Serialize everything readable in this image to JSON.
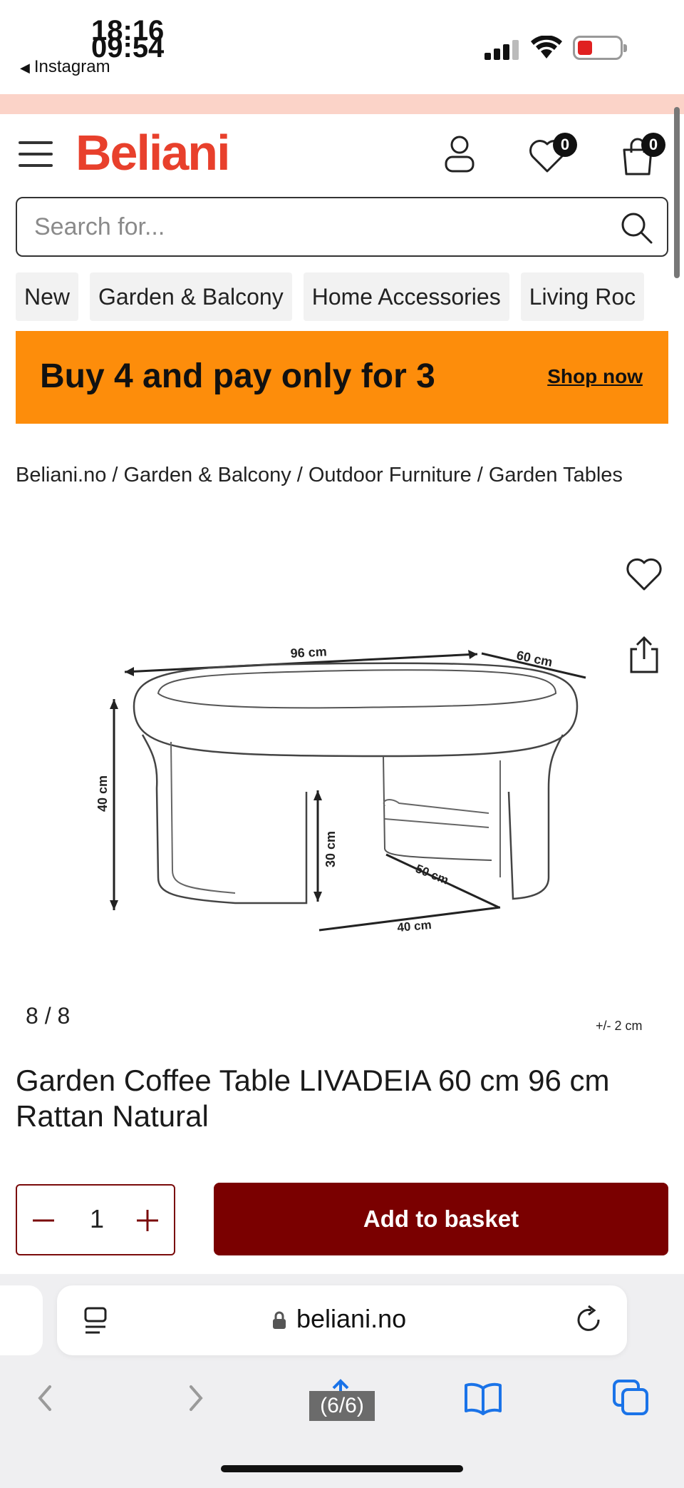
{
  "status_bar": {
    "time_back": "18:16",
    "time_front": "09:54",
    "back_app": "Instagram"
  },
  "header": {
    "logo": "Beliani",
    "wishlist_count": "0",
    "cart_count": "0"
  },
  "search": {
    "placeholder": "Search for..."
  },
  "nav": {
    "items": [
      "New",
      "Garden & Balcony",
      "Home Accessories",
      "Living Roc"
    ]
  },
  "banner": {
    "text": "Buy 4 and pay only for 3",
    "link": "Shop now",
    "color": "#fd8d0b"
  },
  "breadcrumb": [
    "Beliani.no",
    "Garden & Balcony",
    "Outdoor Furniture",
    "Garden Tables"
  ],
  "diagram": {
    "width_label": "96 cm",
    "depth_label": "60 cm",
    "height_label": "40 cm",
    "inner_height_label": "30 cm",
    "inner_depth_label": "50 cm",
    "inner_width_label": "40 cm"
  },
  "gallery": {
    "counter": "8 / 8",
    "tolerance": "+/- 2 cm"
  },
  "product": {
    "title": "Garden Coffee Table LIVADEIA 60 cm 96 cm Rattan Natural",
    "quantity": "1",
    "add_to_basket": "Add to basket",
    "button_color": "#7a0000"
  },
  "browser": {
    "url": "beliani.no",
    "overlay": "(6/6)"
  },
  "colors": {
    "brand": "#e8402c",
    "promo_strip": "#fbd3c8"
  }
}
